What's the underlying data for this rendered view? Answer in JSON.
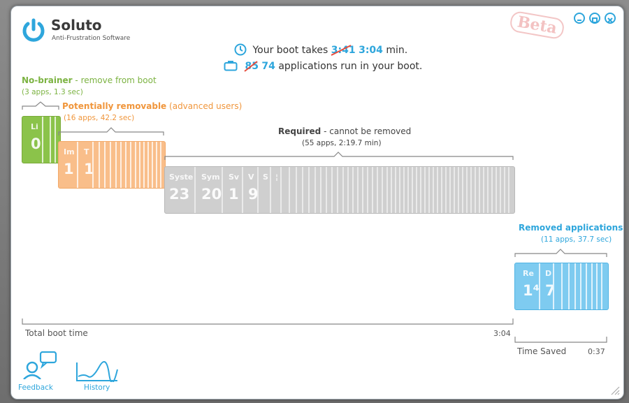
{
  "app": {
    "name": "Soluto",
    "tagline": "Anti-Frustration Software",
    "beta": "Beta"
  },
  "summary": {
    "boot_prefix": "Your boot takes",
    "boot_old": "3:41",
    "boot_new": "3:04",
    "boot_suffix": "min.",
    "apps_old": "85",
    "apps_new": "74",
    "apps_suffix": "applications run in your boot."
  },
  "groups": {
    "nobrainer": {
      "title": "No-brainer",
      "desc": "remove from boot",
      "stats": "(3 apps, 1.3 sec)",
      "tiles": [
        {
          "name": "Li",
          "num": "0"
        }
      ]
    },
    "potential": {
      "title": "Potentially removable",
      "desc": "(advanced users)",
      "stats": "(16 apps, 42.2 sec)",
      "tiles": [
        {
          "name": "Im",
          "num": "1"
        },
        {
          "name": "T",
          "num": "1"
        }
      ]
    },
    "required": {
      "title": "Required",
      "desc": "cannot be removed",
      "stats": "(55 apps, 2:19.7 min)",
      "tiles": [
        {
          "name": "Syste",
          "num": "23"
        },
        {
          "name": "Sym",
          "num": "20"
        },
        {
          "name": "Sv",
          "num": "1"
        },
        {
          "name": "V",
          "num": "9"
        },
        {
          "name": "S",
          "num": ""
        },
        {
          "name": "¦",
          "num": ""
        }
      ]
    },
    "removed": {
      "title": "Removed applications",
      "stats": "(11 apps, 37.7 sec)",
      "tiles": [
        {
          "name": "Re",
          "num": "1⁴"
        },
        {
          "name": "D",
          "num": "7"
        }
      ]
    }
  },
  "timeline": {
    "total_label": "Total boot time",
    "total_value": "3:04",
    "saved_label": "Time Saved",
    "saved_value": "0:37"
  },
  "footer": {
    "feedback": "Feedback",
    "history": "History"
  },
  "colors": {
    "accent": "#2ea6dc",
    "green": "#8bc34a",
    "orange": "#f9be8a",
    "gray": "#cfcfcf",
    "blue": "#7ecbf0"
  }
}
